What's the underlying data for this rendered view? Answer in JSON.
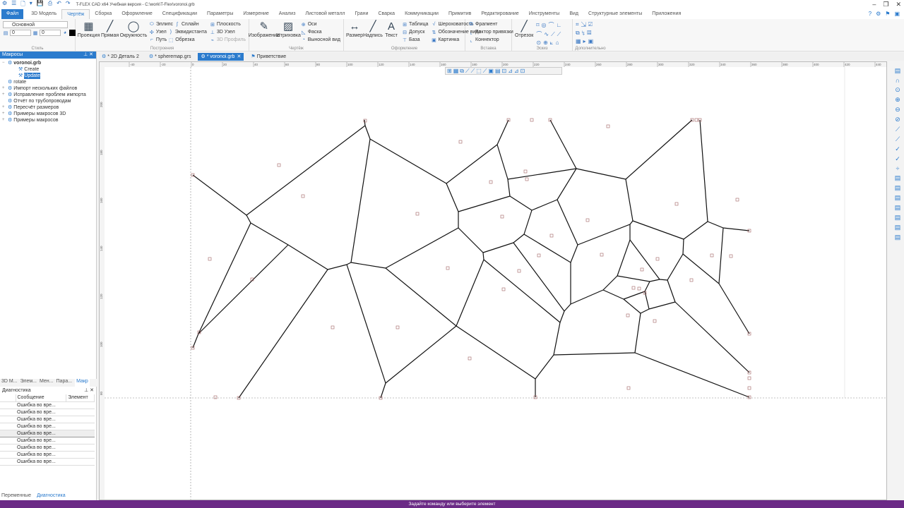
{
  "window": {
    "title": "T-FLEX CAD x64 Учебная версия - C:\\work\\T-Flex\\voronoi.grb"
  },
  "menu_tabs": [
    "Файл",
    "3D Модель",
    "Чертёж",
    "Сборка",
    "Оформление",
    "Спецификации",
    "Параметры",
    "Измерение",
    "Анализ",
    "Листовой металл",
    "Грани",
    "Сварка",
    "Коммуникации",
    "Примитив",
    "Редактирование",
    "Инструменты",
    "Вид",
    "Структурные элементы",
    "Приложения"
  ],
  "ribbon": {
    "style": {
      "layer": "Основной",
      "spin1": "0",
      "spin2": "0",
      "color": "#000000",
      "label": "Стиль"
    },
    "build": {
      "projection": "Проекция",
      "line": "Прямая",
      "circle": "Окружность",
      "ellipse": "Эллипс",
      "spline": "Сплайн",
      "node": "Узел",
      "offset": "Эквидистанта",
      "path": "Путь",
      "trim": "Обрезка",
      "plane": "Плоскость",
      "node3d": "3D Узел",
      "profile3d": "3D Профиль",
      "label": "Построения"
    },
    "drawing": {
      "image": "Изображение",
      "hatch": "Штриховка",
      "axes": "Оси",
      "chamfer": "Фаска",
      "detail": "Выносной вид",
      "label": "Чертёж"
    },
    "annot": {
      "dimension": "Размер",
      "note": "Надпись",
      "text": "Текст",
      "table": "Таблица",
      "tolerance": "Допуск",
      "datum": "База",
      "roughness": "Шероховатость",
      "viewmark": "Обозначение вида",
      "picture": "Картинка",
      "label": "Оформление"
    },
    "insert": {
      "fragment": "Фрагмент",
      "vector": "Вектор привязки",
      "connector": "Коннектор",
      "label": "Вставка"
    },
    "sketch": {
      "segment": "Отрезок",
      "label": "Эскиз"
    },
    "extra": {
      "label": "Дополнительно"
    }
  },
  "doc_tabs": [
    "* 2D Деталь 2",
    "* spheremap.grs",
    "* voronoi.grb",
    "Приветствие"
  ],
  "macros": {
    "title": "Макросы",
    "items": [
      {
        "label": "voronoi.grb",
        "level": 0,
        "exp": "−"
      },
      {
        "label": "Create",
        "level": 1
      },
      {
        "label": "Update",
        "level": 1,
        "selected": true
      },
      {
        "label": "rotate",
        "level": 0
      },
      {
        "label": "Импорт нескольких файлов",
        "level": 0,
        "exp": "+"
      },
      {
        "label": "Исправление проблем импорта",
        "level": 0,
        "exp": "+"
      },
      {
        "label": "Отчёт по трубопроводам",
        "level": 0
      },
      {
        "label": "Пересчёт размеров",
        "level": 0,
        "exp": "+"
      },
      {
        "label": "Примеры макросов 3D",
        "level": 0,
        "exp": "+"
      },
      {
        "label": "Примеры макросов",
        "level": 0,
        "exp": "+"
      }
    ]
  },
  "left_tabs": [
    "3D М...",
    "Элем...",
    "Мен...",
    "Пара...",
    "Макр"
  ],
  "diagnostics": {
    "title": "Диагностика",
    "columns": [
      "Сообщение",
      "Элемент"
    ],
    "rows": [
      "Ошибка во вре...",
      "Ошибка во вре...",
      "Ошибка во вре...",
      "Ошибка во вре...",
      "Ошибка во вре...",
      "Ошибка во вре...",
      "Ошибка во вре...",
      "Ошибка во вре...",
      "Ошибка во вре..."
    ]
  },
  "bottom_tabs": [
    "Переменные",
    "Диагностика"
  ],
  "ruler_top": [
    "-40",
    "-20",
    "0",
    "20",
    "40",
    "60",
    "80",
    "100",
    "120",
    "140",
    "160",
    "180",
    "200",
    "220",
    "240",
    "260",
    "280",
    "300",
    "320",
    "340",
    "360",
    "380",
    "400",
    "420",
    "440"
  ],
  "ruler_left": [
    "200",
    "180",
    "160",
    "140",
    "120",
    "100",
    "80"
  ],
  "status": "Задайте команду или выберите элемент"
}
